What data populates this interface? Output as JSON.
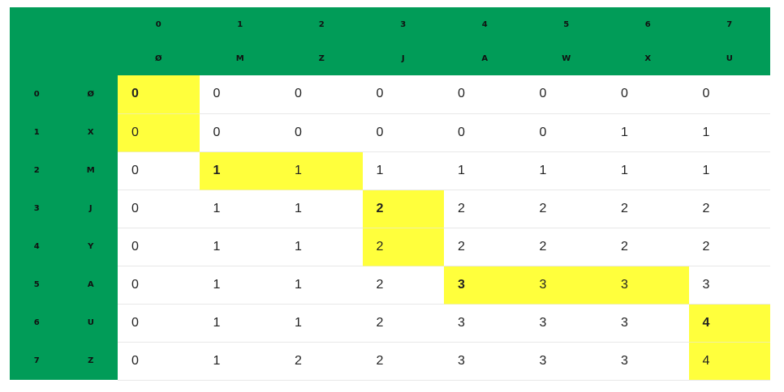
{
  "columns": {
    "indices": [
      "0",
      "1",
      "2",
      "3",
      "4",
      "5",
      "6",
      "7"
    ],
    "letters": [
      "Ø",
      "M",
      "Z",
      "J",
      "A",
      "W",
      "X",
      "U"
    ]
  },
  "rows": [
    {
      "index": "0",
      "letter": "Ø",
      "values": [
        "0",
        "0",
        "0",
        "0",
        "0",
        "0",
        "0",
        "0"
      ]
    },
    {
      "index": "1",
      "letter": "X",
      "values": [
        "0",
        "0",
        "0",
        "0",
        "0",
        "0",
        "1",
        "1"
      ]
    },
    {
      "index": "2",
      "letter": "M",
      "values": [
        "0",
        "1",
        "1",
        "1",
        "1",
        "1",
        "1",
        "1"
      ]
    },
    {
      "index": "3",
      "letter": "J",
      "values": [
        "0",
        "1",
        "1",
        "2",
        "2",
        "2",
        "2",
        "2"
      ]
    },
    {
      "index": "4",
      "letter": "Y",
      "values": [
        "0",
        "1",
        "1",
        "2",
        "2",
        "2",
        "2",
        "2"
      ]
    },
    {
      "index": "5",
      "letter": "A",
      "values": [
        "0",
        "1",
        "1",
        "2",
        "3",
        "3",
        "3",
        "3"
      ]
    },
    {
      "index": "6",
      "letter": "U",
      "values": [
        "0",
        "1",
        "1",
        "2",
        "3",
        "3",
        "3",
        "4"
      ]
    },
    {
      "index": "7",
      "letter": "Z",
      "values": [
        "0",
        "1",
        "2",
        "2",
        "3",
        "3",
        "3",
        "4"
      ]
    }
  ],
  "highlight_color": "#ffff3c",
  "header_color": "#019c58",
  "highlighted_cells": [
    [
      0,
      0
    ],
    [
      1,
      0
    ],
    [
      2,
      1
    ],
    [
      2,
      2
    ],
    [
      3,
      3
    ],
    [
      4,
      3
    ],
    [
      5,
      4
    ],
    [
      5,
      5
    ],
    [
      5,
      6
    ],
    [
      6,
      7
    ],
    [
      7,
      7
    ]
  ],
  "bold_cells": [
    [
      0,
      0
    ],
    [
      2,
      1
    ],
    [
      3,
      3
    ],
    [
      5,
      4
    ],
    [
      6,
      7
    ]
  ]
}
